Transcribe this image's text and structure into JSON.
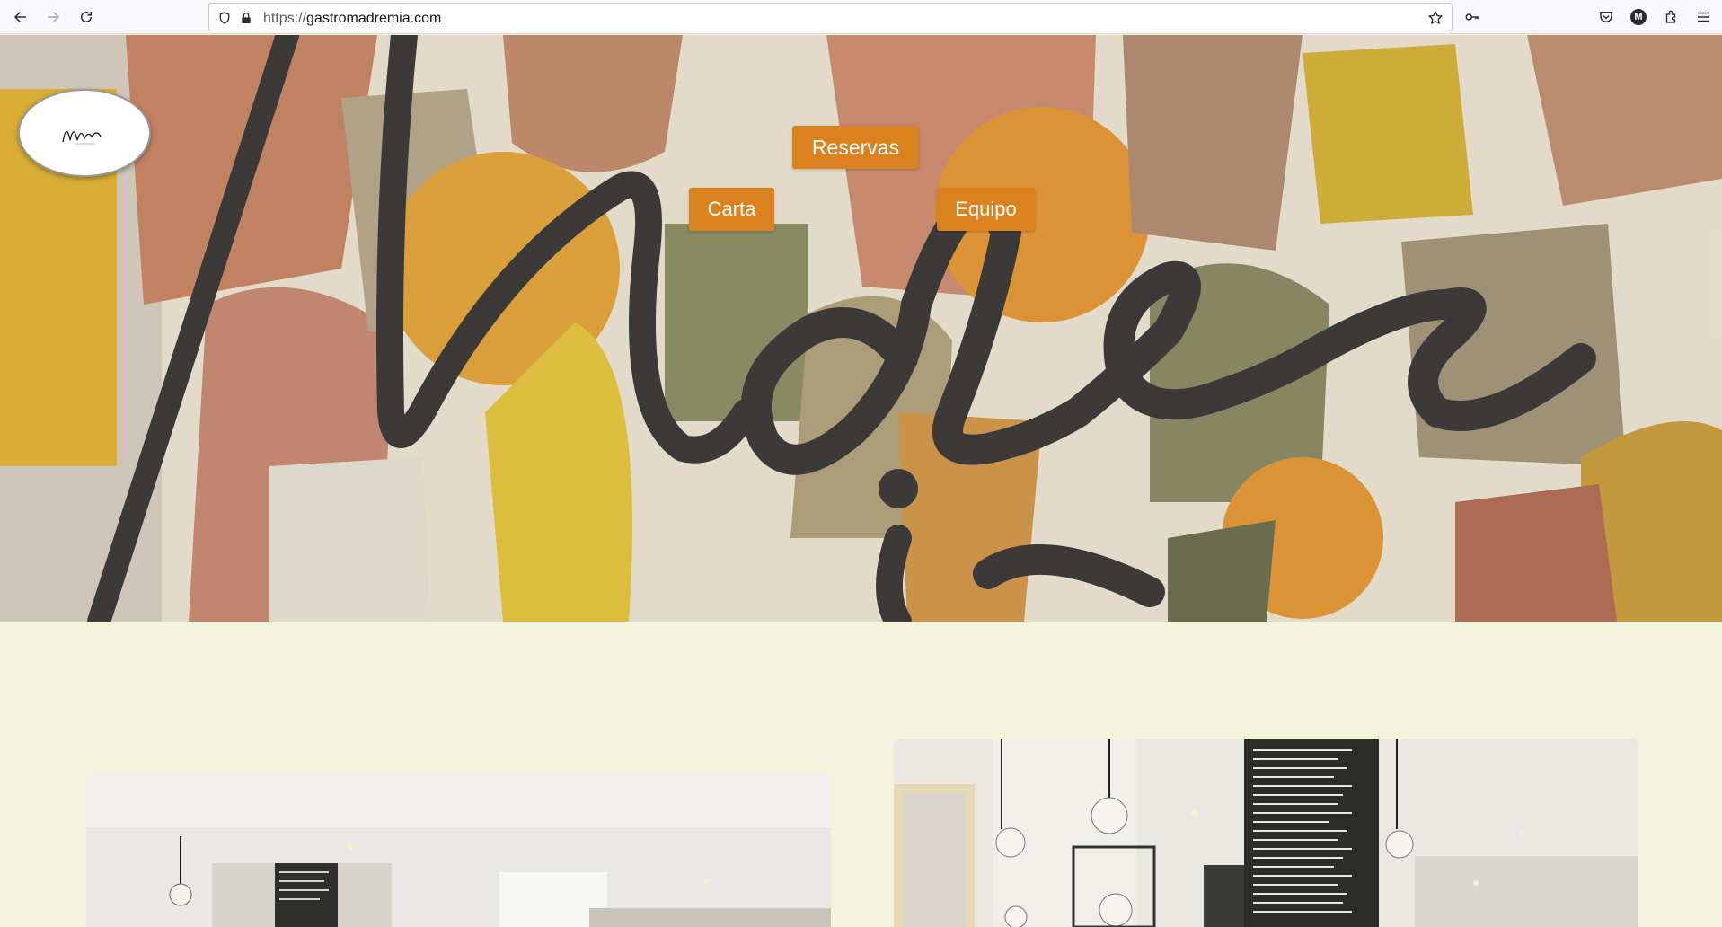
{
  "browser": {
    "url_protocol": "https://",
    "url_domain": "gastromadremia.com",
    "profile_initial": "M",
    "icons": [
      "back-icon",
      "forward-icon",
      "reload-icon",
      "shield-icon",
      "lock-icon",
      "star-icon",
      "key-icon",
      "pocket-icon",
      "extensions-icon",
      "menu-icon"
    ]
  },
  "hero": {
    "logo_alt": "Madre",
    "nav": {
      "reservas": "Reservas",
      "carta": "Carta",
      "equipo": "Equipo"
    },
    "accent_color": "#d9821f"
  },
  "colors": {
    "page_background": "#f4f3dc",
    "button_background": "#d9821f",
    "button_text": "#ffffff"
  }
}
